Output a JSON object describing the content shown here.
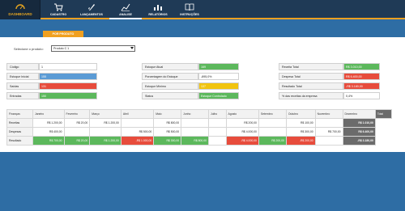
{
  "topbar": {
    "logo_label": "DASHBOARD",
    "nav": [
      {
        "label": "CADASTRO",
        "icon": "cart-icon"
      },
      {
        "label": "LANÇAMENTOS",
        "icon": "rocket-icon"
      },
      {
        "label": "ANALISE",
        "icon": "chart-icon",
        "active": true
      },
      {
        "label": "RELATÓRIOS",
        "icon": "bar-chart-icon"
      },
      {
        "label": "INSTRUÇÕES",
        "icon": "book-icon"
      }
    ]
  },
  "tab": {
    "label": "POR PRODUTO"
  },
  "selector": {
    "label": "Selecione o produto:",
    "value": "Produto C 1"
  },
  "info_left": [
    {
      "k": "Código",
      "v": "1"
    },
    {
      "k": "Estoque Inicial",
      "v": "155"
    },
    {
      "k": "Saídas",
      "v": "131"
    },
    {
      "k": "Entradas",
      "v": "150"
    }
  ],
  "info_mid": [
    {
      "k": "Estoque Atual",
      "v": "169"
    },
    {
      "k": "Porcentagem do Estoque",
      "v": "-895,0%"
    },
    {
      "k": "Estoque Mínimo",
      "v": "137"
    },
    {
      "k": "Status",
      "v": "Estoque Controlado"
    }
  ],
  "info_right": [
    {
      "k": "Receita Total",
      "v": "R$ 3.010,00"
    },
    {
      "k": "Despesa Total",
      "v": "R$ 6.400,00"
    },
    {
      "k": "Resultado Total",
      "v": "-R$ 3.180,00"
    },
    {
      "k": "% das receitas da empresa",
      "v": "0,4%"
    }
  ],
  "table": {
    "headers": [
      "Finanças",
      "Janeiro",
      "Fevereiro",
      "Março",
      "Abril",
      "Maio",
      "Junho",
      "Julho",
      "Agosto",
      "Setembro",
      "Outubro",
      "Novembro",
      "Dezembro",
      "Total"
    ],
    "rows": [
      {
        "name": "Receitas",
        "cells": [
          "R$ 1.200,00",
          "R$ 20,00",
          "R$ 1.200,00",
          "",
          "R$ 800,00",
          "",
          "",
          "R$ 200,00",
          "",
          "R$ 100,00",
          "",
          "R$ 1.010,00"
        ]
      },
      {
        "name": "Despesas",
        "cells": [
          "R$ 400,00",
          "",
          "",
          "R$ 500,00",
          "R$ 500,00",
          "",
          "",
          "R$ 4.000,00",
          "",
          "R$ 300,00",
          "R$ 700,00",
          "R$ 6.400,00"
        ]
      },
      {
        "name": "Resultado",
        "cells": [
          "R$ 700,00",
          "R$ 20,00",
          "R$ 1.200,00",
          "-R$ 1.000,00",
          "R$ 300,00",
          "R$ 800,00",
          "",
          "-R$ 4.000,00",
          "R$ 200,00",
          "-R$ 200,00",
          "",
          "-R$ 3.180,00"
        ]
      }
    ]
  }
}
